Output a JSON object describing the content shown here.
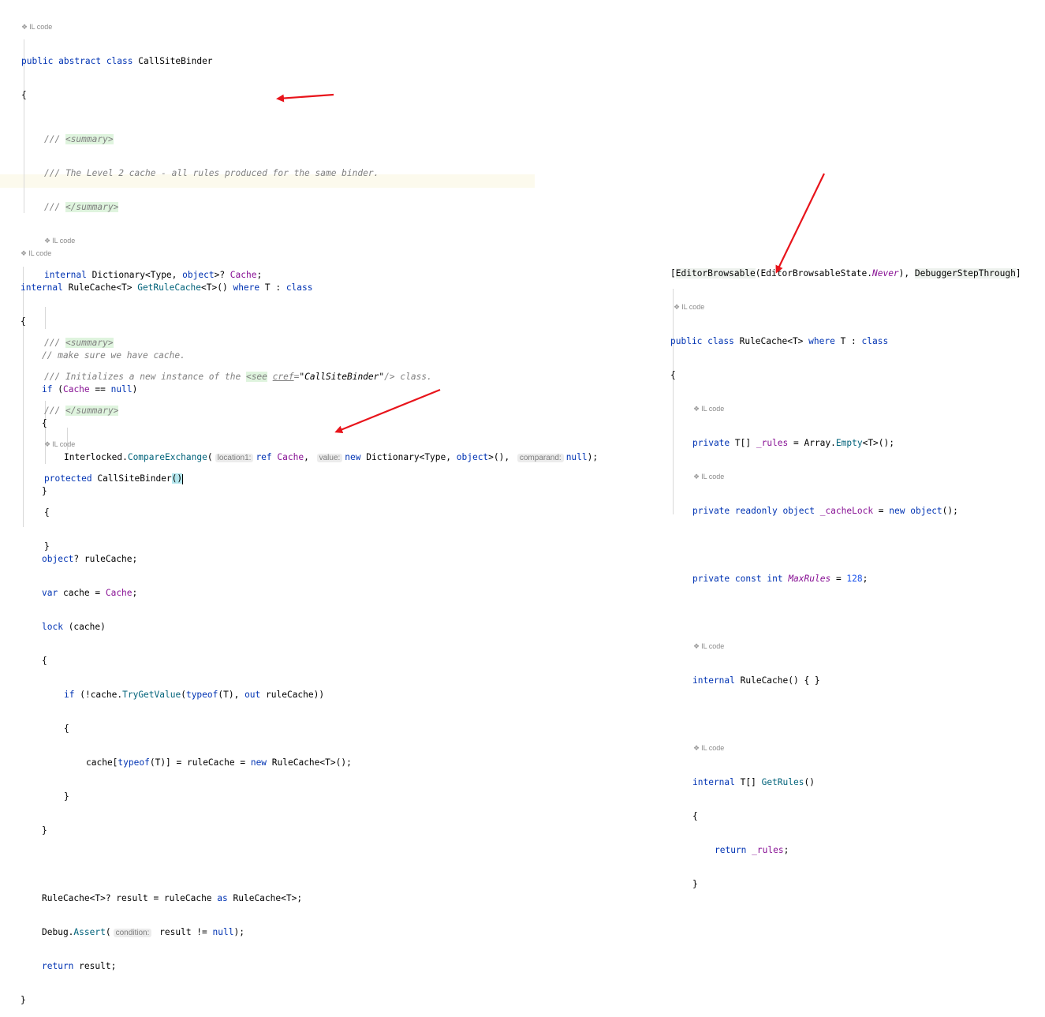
{
  "il_label": "IL code",
  "block1": {
    "class_decl": {
      "kw1": "public",
      "kw2": "abstract",
      "kw3": "class",
      "name": "CallSiteBinder"
    },
    "open_brace": "{",
    "summary1_open_prefix": "/// ",
    "summary_tag_open": "<summary>",
    "summary1_text": "/// The Level 2 cache - all rules produced for the same binder.",
    "summary_tag_close": "</summary>",
    "cache_decl": {
      "kw": "internal",
      "type_start": "Dictionary<Type, ",
      "obj_kw": "object",
      "type_end": ">? ",
      "field": "Cache",
      "semi": ";"
    },
    "summary2_text_pre": "/// Initializes a new instance of the ",
    "see_tag": "<see",
    "cref_attr": "cref",
    "cref_eq": "=",
    "cref_val": "\"CallSiteBinder\"",
    "see_close": "/>",
    "summary2_text_post": " class.",
    "ctor": {
      "kw": "protected",
      "name": "CallSiteBinder",
      "parens": "()"
    },
    "ctor_open": "{",
    "ctor_close": "}"
  },
  "block2": {
    "sig": {
      "kw": "internal",
      "ret": "RuleCache<T> ",
      "method": "GetRuleCache",
      "rest": "<T>() ",
      "where_kw": "where",
      "constraint": " T : ",
      "class_kw": "class"
    },
    "open_brace": "{",
    "comment": "// make sure we have cache.",
    "if1": {
      "kw": "if",
      "open": " (",
      "field": "Cache",
      "mid": " == ",
      "null_kw": "null",
      "close": ")"
    },
    "brace_open1": "{",
    "exchange": {
      "cls": "Interlocked.",
      "method": "CompareExchange",
      "open": "(",
      "hint1": "location1:",
      "ref_kw": "ref",
      "field": "Cache",
      "comma1": ",",
      "hint2": "value:",
      "new_kw": "new",
      "dict": " Dictionary<Type, ",
      "obj_kw": "object",
      "dict_end": ">(),",
      "hint3": "comparand:",
      "null_kw": "null",
      "end": ");"
    },
    "brace_close1": "}",
    "rulecache_decl": {
      "obj_kw": "object",
      "rest": "? ruleCache;"
    },
    "var_line": {
      "var_kw": "var",
      "rest": " cache = ",
      "field": "Cache",
      "semi": ";"
    },
    "lock_line": {
      "kw": "lock",
      "rest": " (cache)"
    },
    "brace_open2": "{",
    "if2": {
      "kw": "if",
      "pre": " (!cache.",
      "method": "TryGetValue",
      "open": "(",
      "typeof_kw": "typeof",
      "mid": "(T), ",
      "out_kw": "out",
      "rest": " ruleCache))"
    },
    "brace_open3": "{",
    "assign": {
      "pre": "cache[",
      "typeof_kw": "typeof",
      "mid": "(T)] = ruleCache = ",
      "new_kw": "new",
      "rest": " RuleCache<T>();"
    },
    "brace_close3": "}",
    "brace_close2": "}",
    "result_line": {
      "pre": "RuleCache<T>? result = ruleCache ",
      "as_kw": "as",
      "rest": " RuleCache<T>;"
    },
    "assert_line": {
      "cls": "Debug.",
      "method": "Assert",
      "open": "(",
      "hint": "condition:",
      "rest": " result != ",
      "null_kw": "null",
      "end": ");"
    },
    "return_line": {
      "kw": "return",
      "rest": " result;"
    },
    "close_brace": "}"
  },
  "block3": {
    "attr_line": {
      "open": "[",
      "a1": "EditorBrowsable",
      "p1": "(EditorBrowsableState.",
      "never": "Never",
      "p2": "), ",
      "a2": "DebuggerStepThrough",
      "close": "]"
    },
    "class_decl": {
      "kw1": "public",
      "kw2": "class",
      "name": " RuleCache<T> ",
      "where_kw": "where",
      "constraint": " T : ",
      "class_kw": "class"
    },
    "open_brace": "{",
    "rules_line": {
      "kw": "private",
      "type": " T[] ",
      "field": "_rules",
      "mid": " = Array.",
      "method": "Empty",
      "rest": "<T>();"
    },
    "lock_line": {
      "kw1": "private",
      "kw2": "readonly",
      "kw3": "object",
      "field": " _cacheLock",
      "mid": " = ",
      "new_kw": "new",
      "obj_kw": "object",
      "rest": "();"
    },
    "max_line": {
      "kw1": "private",
      "kw2": "const",
      "kw3": "int",
      "field": "MaxRules",
      "mid": " = ",
      "num": "128",
      "semi": ";"
    },
    "ctor_line": {
      "kw": "internal",
      "rest": " RuleCache() { }"
    },
    "getrules_line": {
      "kw": "internal",
      "type": " T[] ",
      "method": "GetRules",
      "rest": "()"
    },
    "m_open": "{",
    "return_line": {
      "kw": "return",
      "field": " _rules",
      "semi": ";"
    },
    "m_close": "}"
  },
  "colors": {
    "arrow": "#e8141b",
    "keyword": "#0033b3",
    "field": "#871094",
    "method": "#00627a"
  }
}
